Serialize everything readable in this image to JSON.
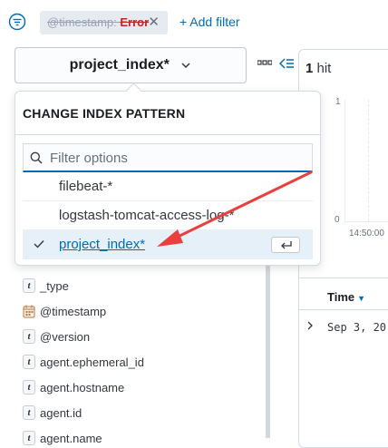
{
  "filter_bar": {
    "filter_pill": {
      "field": "@timestamp: ",
      "value": "Error"
    },
    "add_filter_label": "+ Add filter"
  },
  "index_pattern_button": {
    "label": "project_index*"
  },
  "popover": {
    "title": "CHANGE INDEX PATTERN",
    "search": {
      "placeholder": "Filter options",
      "value": ""
    },
    "options": [
      {
        "label": "filebeat-*",
        "selected": false
      },
      {
        "label": "logstash-tomcat-access-log-*",
        "selected": false
      },
      {
        "label": "project_index*",
        "selected": true
      }
    ]
  },
  "results": {
    "hit_count": "1",
    "hit_label": " hit",
    "chart": {
      "y_max": "1",
      "y_min": "0",
      "x_tick": "14:50:00"
    },
    "table_header": "Time",
    "first_row_date": "Sep 3, 20"
  },
  "fields": [
    {
      "type": "t",
      "name": "_type"
    },
    {
      "type": "date",
      "name": "@timestamp"
    },
    {
      "type": "t",
      "name": "@version"
    },
    {
      "type": "t",
      "name": "agent.ephemeral_id"
    },
    {
      "type": "t",
      "name": "agent.hostname"
    },
    {
      "type": "t",
      "name": "agent.id"
    },
    {
      "type": "t",
      "name": "agent.name"
    }
  ],
  "colors": {
    "accent": "#006bb4",
    "error": "#bd271e",
    "annotation_arrow": "#e8403d",
    "selected_bg": "#e6f0f8"
  },
  "icons": [
    "filter-icon",
    "close-icon",
    "chevron-down-icon",
    "more-dots-icon",
    "collapse-icon",
    "search-icon",
    "check-icon",
    "enter-key-icon",
    "calendar-icon",
    "expand-row-icon"
  ]
}
